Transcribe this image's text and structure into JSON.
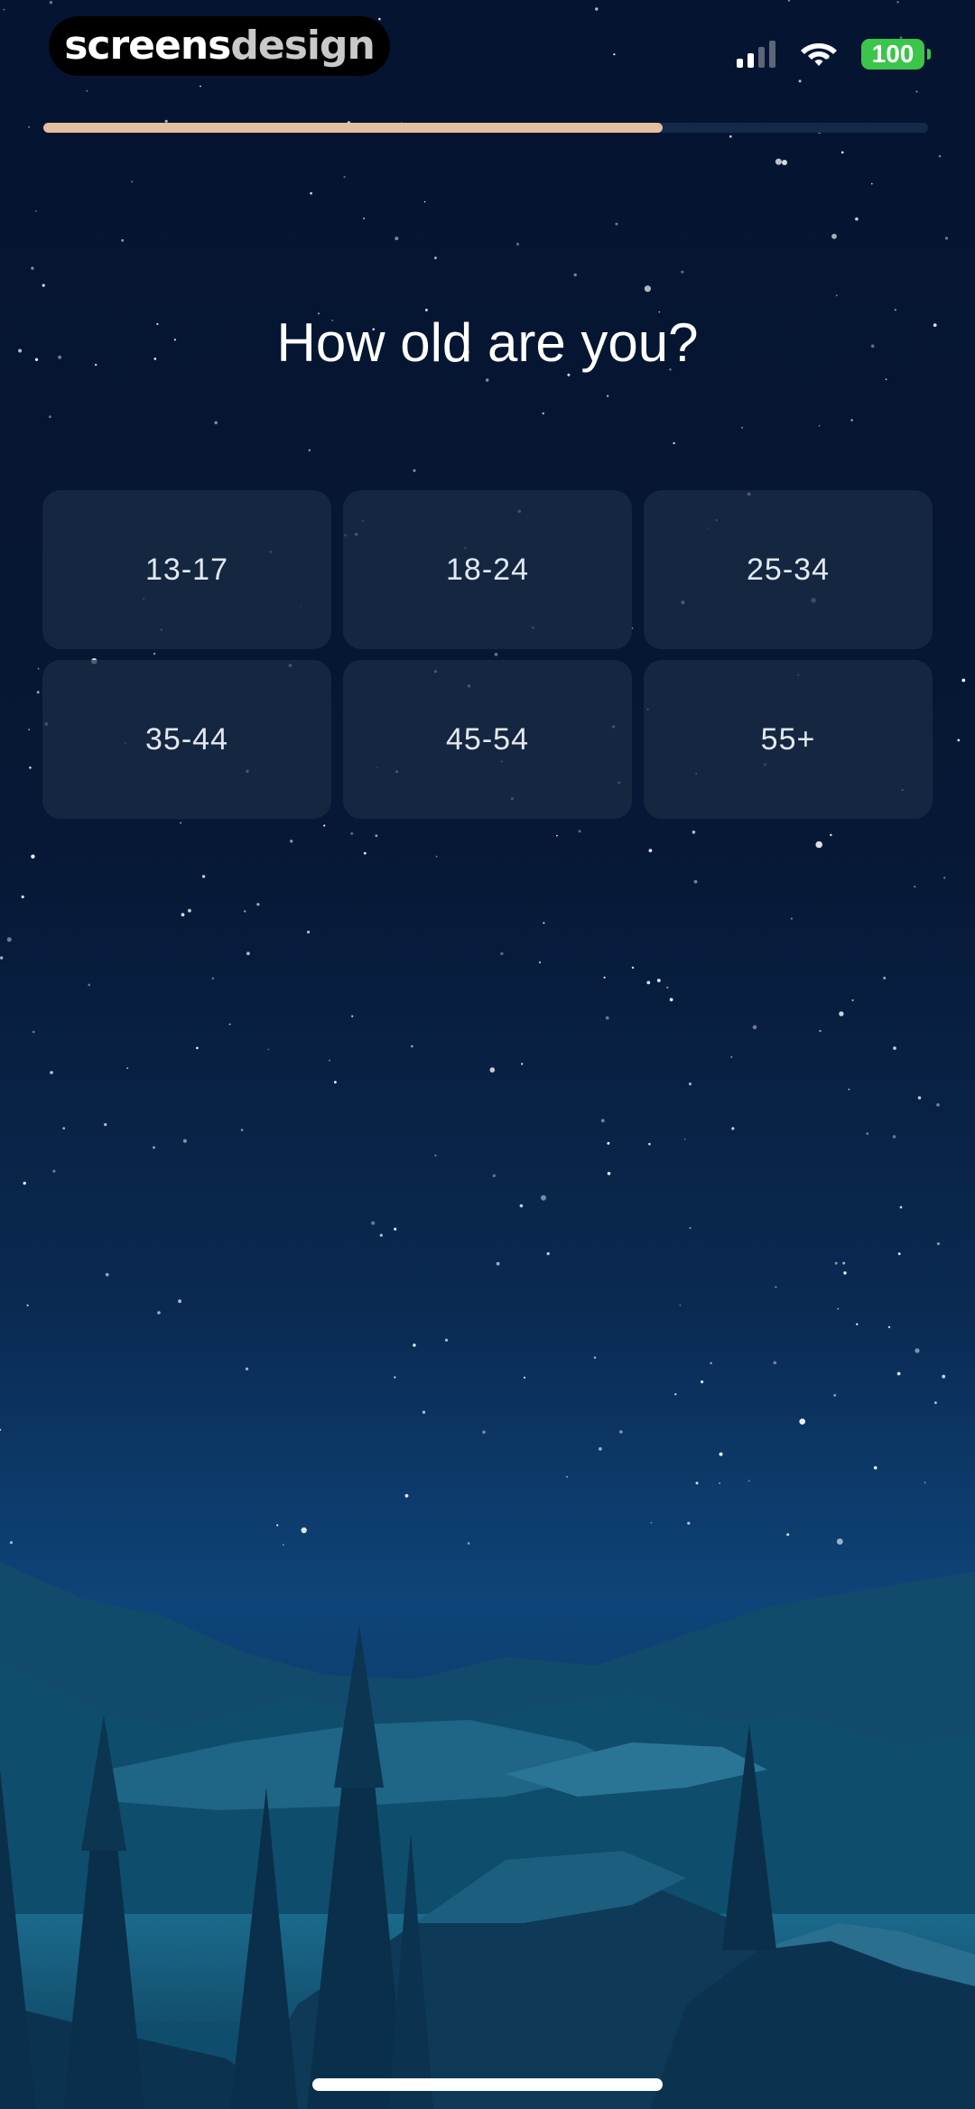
{
  "status_bar": {
    "brand_part1": "screens",
    "brand_part2": "design",
    "battery_level": "100",
    "signal_icon": "cellular-signal-icon",
    "wifi_icon": "wifi-icon"
  },
  "progress": {
    "fraction": 0.7
  },
  "question": "How old are you?",
  "options": [
    {
      "label": "13-17"
    },
    {
      "label": "18-24"
    },
    {
      "label": "25-34"
    },
    {
      "label": "35-44"
    },
    {
      "label": "45-54"
    },
    {
      "label": "55+"
    }
  ],
  "colors": {
    "progress_fill": "#e3bea0",
    "progress_track": "#132a48",
    "battery": "#3bc54a",
    "background_top": "#051430",
    "option_background": "#1c2c46"
  }
}
